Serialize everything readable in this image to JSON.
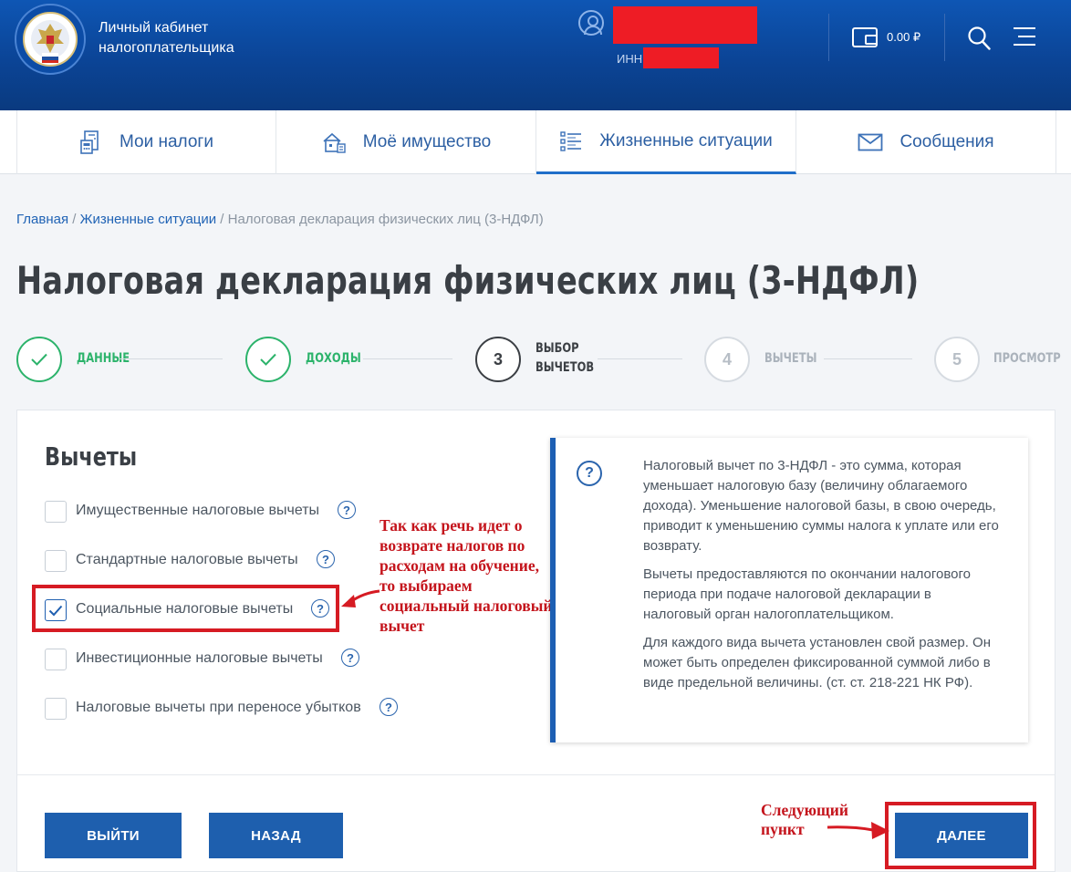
{
  "header": {
    "brand_line1": "Личный кабинет",
    "brand_line2": "налогоплательщика",
    "inn_label": "ИНН",
    "wallet_amount": "0.00 ₽",
    "redaction_color": "#ee1c25"
  },
  "nav": {
    "tabs": [
      {
        "label": "Мои налоги",
        "icon": "document-calc-icon",
        "active": false
      },
      {
        "label": "Моё имущество",
        "icon": "property-icon",
        "active": false
      },
      {
        "label": "Жизненные ситуации",
        "icon": "list-icon",
        "active": true
      },
      {
        "label": "Сообщения",
        "icon": "envelope-icon",
        "active": false
      }
    ]
  },
  "breadcrumb": {
    "home": "Главная",
    "sep1": " / ",
    "section": "Жизненные ситуации",
    "sep2": " / ",
    "current": "Налоговая декларация физических лиц (3-НДФЛ)"
  },
  "page_title": "Налоговая декларация физических лиц (3-НДФЛ)",
  "stepper": [
    {
      "number": "1",
      "label_line1": "ДАННЫЕ",
      "label_line2": "",
      "status": "done"
    },
    {
      "number": "2",
      "label_line1": "ДОХОДЫ",
      "label_line2": "",
      "status": "done"
    },
    {
      "number": "3",
      "label_line1": "ВЫБОР",
      "label_line2": "ВЫЧЕТОВ",
      "status": "current"
    },
    {
      "number": "4",
      "label_line1": "ВЫЧЕТЫ",
      "label_line2": "",
      "status": "todo"
    },
    {
      "number": "5",
      "label_line1": "ПРОСМОТР",
      "label_line2": "",
      "status": "todo"
    }
  ],
  "section_title": "Вычеты",
  "options": [
    {
      "label": "Имущественные налоговые вычеты",
      "checked": false
    },
    {
      "label": "Стандартные налоговые вычеты",
      "checked": false
    },
    {
      "label": "Социальные налоговые вычеты",
      "checked": true
    },
    {
      "label": "Инвестиционные налоговые вычеты",
      "checked": false
    },
    {
      "label": "Налоговые вычеты при переносе убытков",
      "checked": false
    }
  ],
  "info": {
    "p1": "Налоговый вычет по 3-НДФЛ - это сумма, которая уменьшает налоговую базу (величину облагаемого дохода). Уменьшение налоговой базы, в свою очередь, приводит к уменьшению суммы налога к уплате или его возврату.",
    "p2": "Вычеты предоставляются по окончании налогового периода при подаче налоговой декларации в налоговый орган налогоплательщиком.",
    "p3": "Для каждого вида вычета установлен свой размер. Он может быть определен фиксированной суммой либо в виде предельной величины. (ст. ст. 218-221 НК РФ)."
  },
  "annotations": {
    "social": "Так как речь идет о возврате налогов по расходам на обучение, то выбираем социальный налоговый вычет",
    "next": "Следующий пункт"
  },
  "buttons": {
    "exit": "ВЫЙТИ",
    "back": "НАЗАД",
    "next": "ДАЛЕЕ"
  },
  "colors": {
    "header_blue": "#0b4496",
    "accent_blue": "#1e5fae",
    "done_green": "#2cb36b",
    "annotation_red": "#c4141c"
  }
}
